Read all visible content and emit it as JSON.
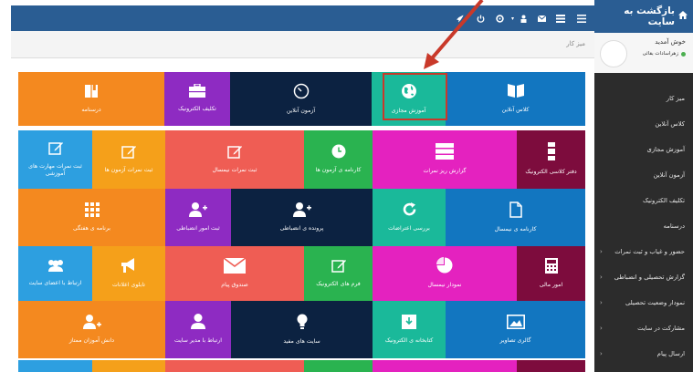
{
  "sidebar": {
    "back_label": "بازگشت به سایت",
    "welcome": "خوش آمدید",
    "user_name": "زهراسادات بقائی",
    "items": [
      {
        "label": "میز کار",
        "has_sub": false
      },
      {
        "label": "کلاس آنلاین",
        "has_sub": false
      },
      {
        "label": "آموزش مجازی",
        "has_sub": false
      },
      {
        "label": "آزمون آنلاین",
        "has_sub": false
      },
      {
        "label": "تکلیف الکترونیک",
        "has_sub": false
      },
      {
        "label": "درسنامه",
        "has_sub": false
      },
      {
        "label": "حضور و غیاب و ثبت نمرات",
        "has_sub": true
      },
      {
        "label": "گزارش تحصیلی و انضباطی",
        "has_sub": true
      },
      {
        "label": "نمودار وضعیت تحصیلی",
        "has_sub": true
      },
      {
        "label": "مشارکت در سایت",
        "has_sub": true
      },
      {
        "label": "ارسال پیام",
        "has_sub": true
      }
    ]
  },
  "topbar": {
    "icons": [
      "menu-icon",
      "grid-icon",
      "mail-icon",
      "user-icon",
      "settings-icon",
      "power-icon",
      "rocket-icon"
    ]
  },
  "breadcrumb": "میز کار",
  "tiles": [
    {
      "label": "درسنامه",
      "icon": "book-icon"
    },
    {
      "label": "تکلیف الکترونیک",
      "icon": "briefcase-icon"
    },
    {
      "label": "آزمون آنلاین",
      "icon": "timer-icon"
    },
    {
      "label": "آموزش مجازی",
      "icon": "globe-icon"
    },
    {
      "label": "کلاس آنلاین",
      "icon": "open-book-icon"
    },
    {
      "label": "ثبت نمرات مهارت های آموزشی",
      "icon": "edit-icon"
    },
    {
      "label": "ثبت نمرات آزمون ها",
      "icon": "edit-icon"
    },
    {
      "label": "ثبت نمرات نیمسال",
      "icon": "edit-icon"
    },
    {
      "label": "کارنامه ی آزمون ها",
      "icon": "clock-icon"
    },
    {
      "label": "گزارش ریز نمرات",
      "icon": "list-icon"
    },
    {
      "label": "دفتر کلاسی الکترونیک",
      "icon": "bars-icon"
    },
    {
      "label": "برنامه ی هفتگی",
      "icon": "dots-grid-icon"
    },
    {
      "label": "ثبت امور انضباطی",
      "icon": "add-user-icon"
    },
    {
      "label": "پرونده ی انضباطی",
      "icon": "add-user-icon"
    },
    {
      "label": "بررسی اعتراضات",
      "icon": "refresh-icon"
    },
    {
      "label": "کارنامه ی نیمسال",
      "icon": "file-icon"
    },
    {
      "label": "ارتباط با اعضای سایت",
      "icon": "users-icon"
    },
    {
      "label": "تابلوی اعلانات",
      "icon": "megaphone-icon"
    },
    {
      "label": "صندوق پیام",
      "icon": "envelope-icon"
    },
    {
      "label": "فرم های الکترونیک",
      "icon": "edit-icon"
    },
    {
      "label": "نمودار نیمسال",
      "icon": "pie-icon"
    },
    {
      "label": "امور مالی",
      "icon": "calculator-icon"
    },
    {
      "label": "دانش آموزان ممتاز",
      "icon": "add-user-icon"
    },
    {
      "label": "ارتباط با مدیر سایت",
      "icon": "user-icon"
    },
    {
      "label": "سایت های مفید",
      "icon": "bulb-icon"
    },
    {
      "label": "کتابخانه ی الکترونیک",
      "icon": "download-icon"
    },
    {
      "label": "گالری تصاویر",
      "icon": "image-icon"
    }
  ]
}
